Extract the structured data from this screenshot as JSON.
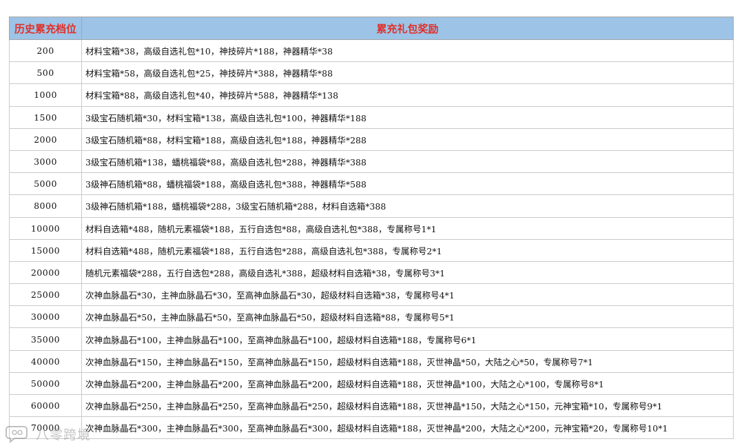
{
  "table": {
    "headers": [
      "历史累充档位",
      "累充礼包奖励"
    ],
    "rows": [
      {
        "tier": "200",
        "reward": "材料宝箱*38，高级自选礼包*10，神技碎片*188，神器精华*38"
      },
      {
        "tier": "500",
        "reward": "材料宝箱*58，高级自选礼包*25，神技碎片*388，神器精华*88"
      },
      {
        "tier": "1000",
        "reward": "材料宝箱*88，高级自选礼包*40，神技碎片*588，神器精华*138"
      },
      {
        "tier": "1500",
        "reward": "3级宝石随机箱*30，材料宝箱*138，高级自选礼包*100，神器精华*188"
      },
      {
        "tier": "2000",
        "reward": "3级宝石随机箱*88，材料宝箱*188，高级自选礼包*188，神器精华*288"
      },
      {
        "tier": "3000",
        "reward": "3级宝石随机箱*138，蟠桃福袋*88，高级自选礼包*288，神器精华*388"
      },
      {
        "tier": "5000",
        "reward": "3级神石随机箱*88，蟠桃福袋*188，高级自选礼包*388，神器精华*588"
      },
      {
        "tier": "8000",
        "reward": "3级神石随机箱*188，蟠桃福袋*288，3级宝石随机箱*288，材料自选箱*388"
      },
      {
        "tier": "10000",
        "reward": "材料自选箱*488，随机元素福袋*188，五行自选包*88，高级自选礼包*388，专属称号1*1"
      },
      {
        "tier": "15000",
        "reward": "材料自选箱*488，随机元素福袋*188，五行自选包*288，高级自选礼包*388，专属称号2*1"
      },
      {
        "tier": "20000",
        "reward": "随机元素福袋*288，五行自选包*288，高级自选礼*388，超级材料自选箱*38，专属称号3*1"
      },
      {
        "tier": "25000",
        "reward": "次神血脉晶石*30，主神血脉晶石*30，至高神血脉晶石*30，超级材料自选箱*38，专属称号4*1"
      },
      {
        "tier": "30000",
        "reward": "次神血脉晶石*50，主神血脉晶石*50，至高神血脉晶石*50，超级材料自选箱*88，专属称号5*1"
      },
      {
        "tier": "35000",
        "reward": "次神血脉晶石*100，主神血脉晶石*100，至高神血脉晶石*100，超级材料自选箱*188，专属称号6*1"
      },
      {
        "tier": "40000",
        "reward": "次神血脉晶石*150，主神血脉晶石*150，至高神血脉晶石*150，超级材料自选箱*188，灭世神晶*50，大陆之心*50，专属称号7*1"
      },
      {
        "tier": "50000",
        "reward": "次神血脉晶石*200，主神血脉晶石*200，至高神血脉晶石*200，超级材料自选箱*188，灭世神晶*100，大陆之心*100，专属称号8*1"
      },
      {
        "tier": "60000",
        "reward": "次神血脉晶石*250，主神血脉晶石*250，至高神血脉晶石*250，超级材料自选箱*188，灭世神晶*150，大陆之心*150，元神宝箱*10，专属称号9*1"
      },
      {
        "tier": "70000",
        "reward": "次神血脉晶石*300，主神血脉晶石*300，至高神血脉晶石*300，超级材料自选箱*188，灭世神晶*200，大陆之心*200，元神宝箱*20，专属称号10*1"
      }
    ]
  },
  "watermark": {
    "text": "八零跨境",
    "icon": "chat-bubble-logo-icon"
  },
  "colors": {
    "header_bg": "#9dc3e6",
    "header_text": "#e0302a",
    "border": "#c9c9c9"
  }
}
